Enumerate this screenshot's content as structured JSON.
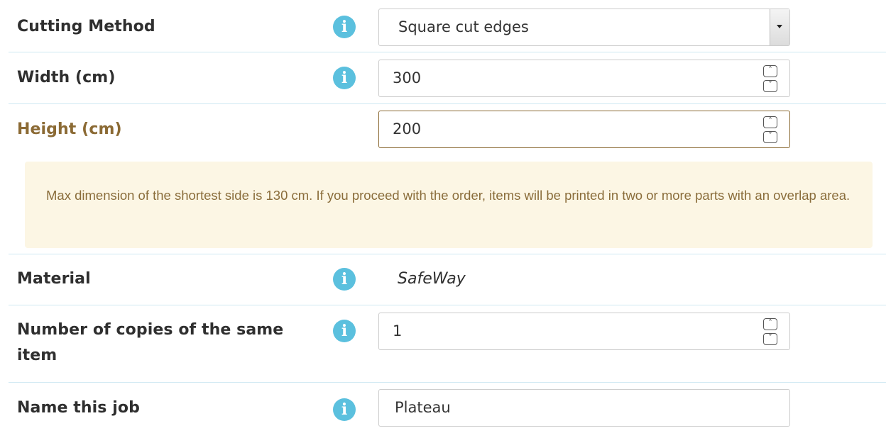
{
  "form": {
    "cutting_method": {
      "label": "Cutting Method",
      "value": "Square cut edges",
      "info_icon": "info-circle-icon"
    },
    "width": {
      "label": "Width (cm)",
      "value": "300",
      "info_icon": "info-circle-icon"
    },
    "height": {
      "label": "Height (cm)",
      "value": "200"
    },
    "alert": {
      "text": "Max dimension of the shortest side is 130 cm. If you proceed with the order, items will be printed in two or more parts with an overlap area."
    },
    "material": {
      "label": "Material",
      "value": "SafeWay",
      "info_icon": "info-circle-icon"
    },
    "copies": {
      "label": "Number of copies of the same item",
      "value": "1",
      "info_icon": "info-circle-icon"
    },
    "job_name": {
      "label": "Name this job",
      "value": "Plateau",
      "info_icon": "info-circle-icon"
    }
  },
  "colors": {
    "info_icon": "#5bc0de",
    "warning_text": "#8b6a34",
    "warning_bg": "#fcf6e4",
    "divider": "#cfe8f2"
  }
}
